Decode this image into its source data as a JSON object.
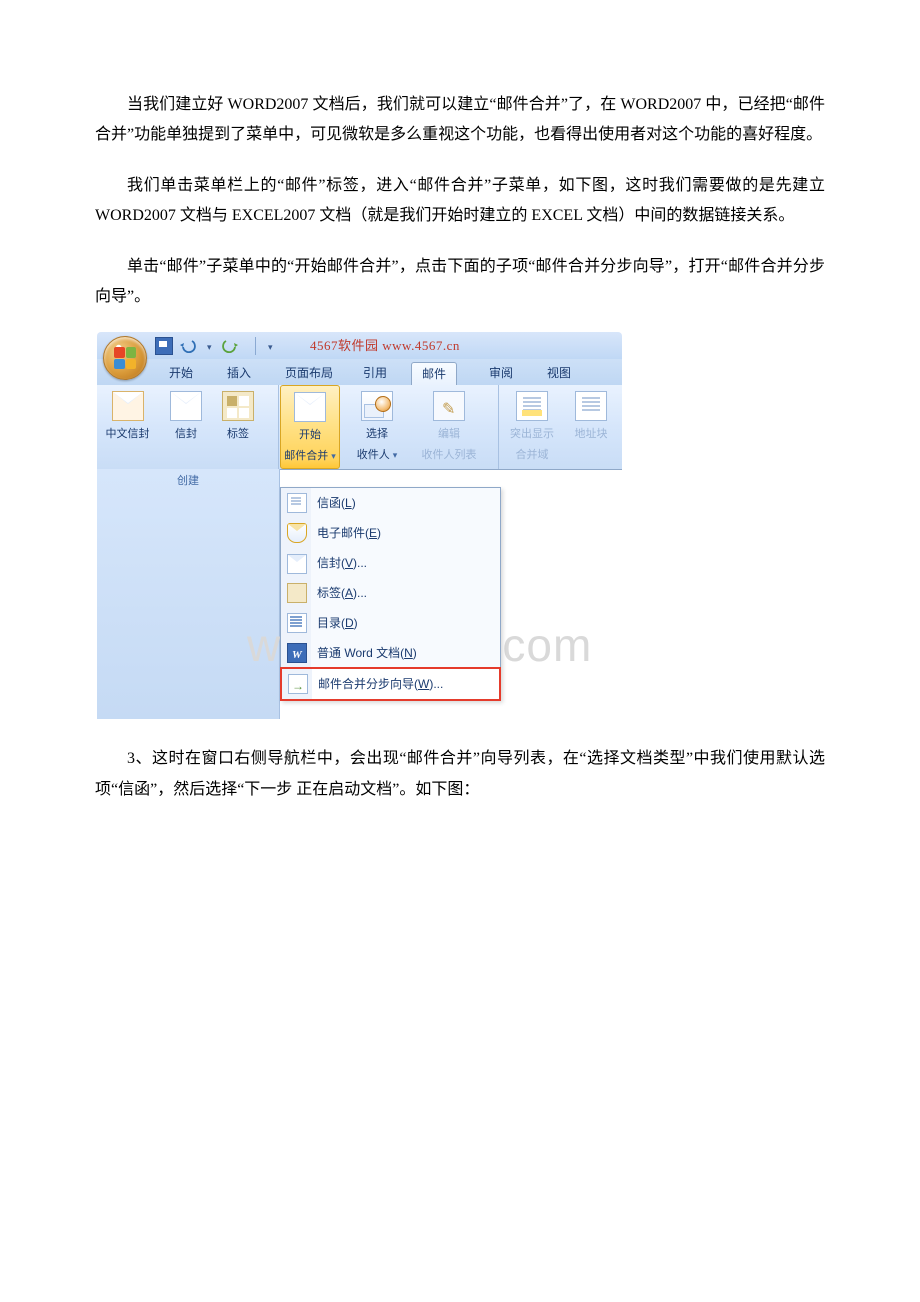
{
  "paragraphs": {
    "p1": "当我们建立好 WORD2007 文档后，我们就可以建立“邮件合并”了，在 WORD2007 中，已经把“邮件合并”功能单独提到了菜单中，可见微软是多么重视这个功能，也看得出使用者对这个功能的喜好程度。",
    "p2": "我们单击菜单栏上的“邮件”标签，进入“邮件合并”子菜单，如下图，这时我们需要做的是先建立 WORD2007 文档与 EXCEL2007 文档（就是我们开始时建立的 EXCEL 文档）中间的数据链接关系。",
    "p3": "单击“邮件”子菜单中的“开始邮件合并”，点击下面的子项“邮件合并分步向导”，打开“邮件合并分步向导”。",
    "p4": "3、这时在窗口右侧导航栏中，会出现“邮件合并”向导列表，在“选择文档类型”中我们使用默认选项“信函”，然后选择“下一步 正在启动文档”。如下图："
  },
  "screenshot": {
    "qat_title": "4567软件园 www.4567.cn",
    "tabs": {
      "home": "开始",
      "insert": "插入",
      "layout": "页面布局",
      "references": "引用",
      "mailings": "邮件",
      "review": "审阅",
      "view": "视图"
    },
    "ribbon": {
      "group_create": "创建",
      "cn_envelope": "中文信封",
      "envelope": "信封",
      "labels": "标签",
      "start_merge_l1": "开始",
      "start_merge_l2": "邮件合并",
      "select_recip_l1": "选择",
      "select_recip_l2": "收件人",
      "edit_recip_l1": "编辑",
      "edit_recip_l2": "收件人列表",
      "highlight_l1": "突出显示",
      "highlight_l2": "合并域",
      "address_block": "地址块"
    },
    "menu": {
      "letters": "信函(L)",
      "email": "电子邮件(E)",
      "envelopes": "信封(V)...",
      "labels": "标签(A)...",
      "directory": "目录(D)",
      "normal_word": "普通 Word 文档(N)",
      "wizard": "邮件合并分步向导(W)..."
    },
    "watermark": "www.bdocx.com"
  }
}
